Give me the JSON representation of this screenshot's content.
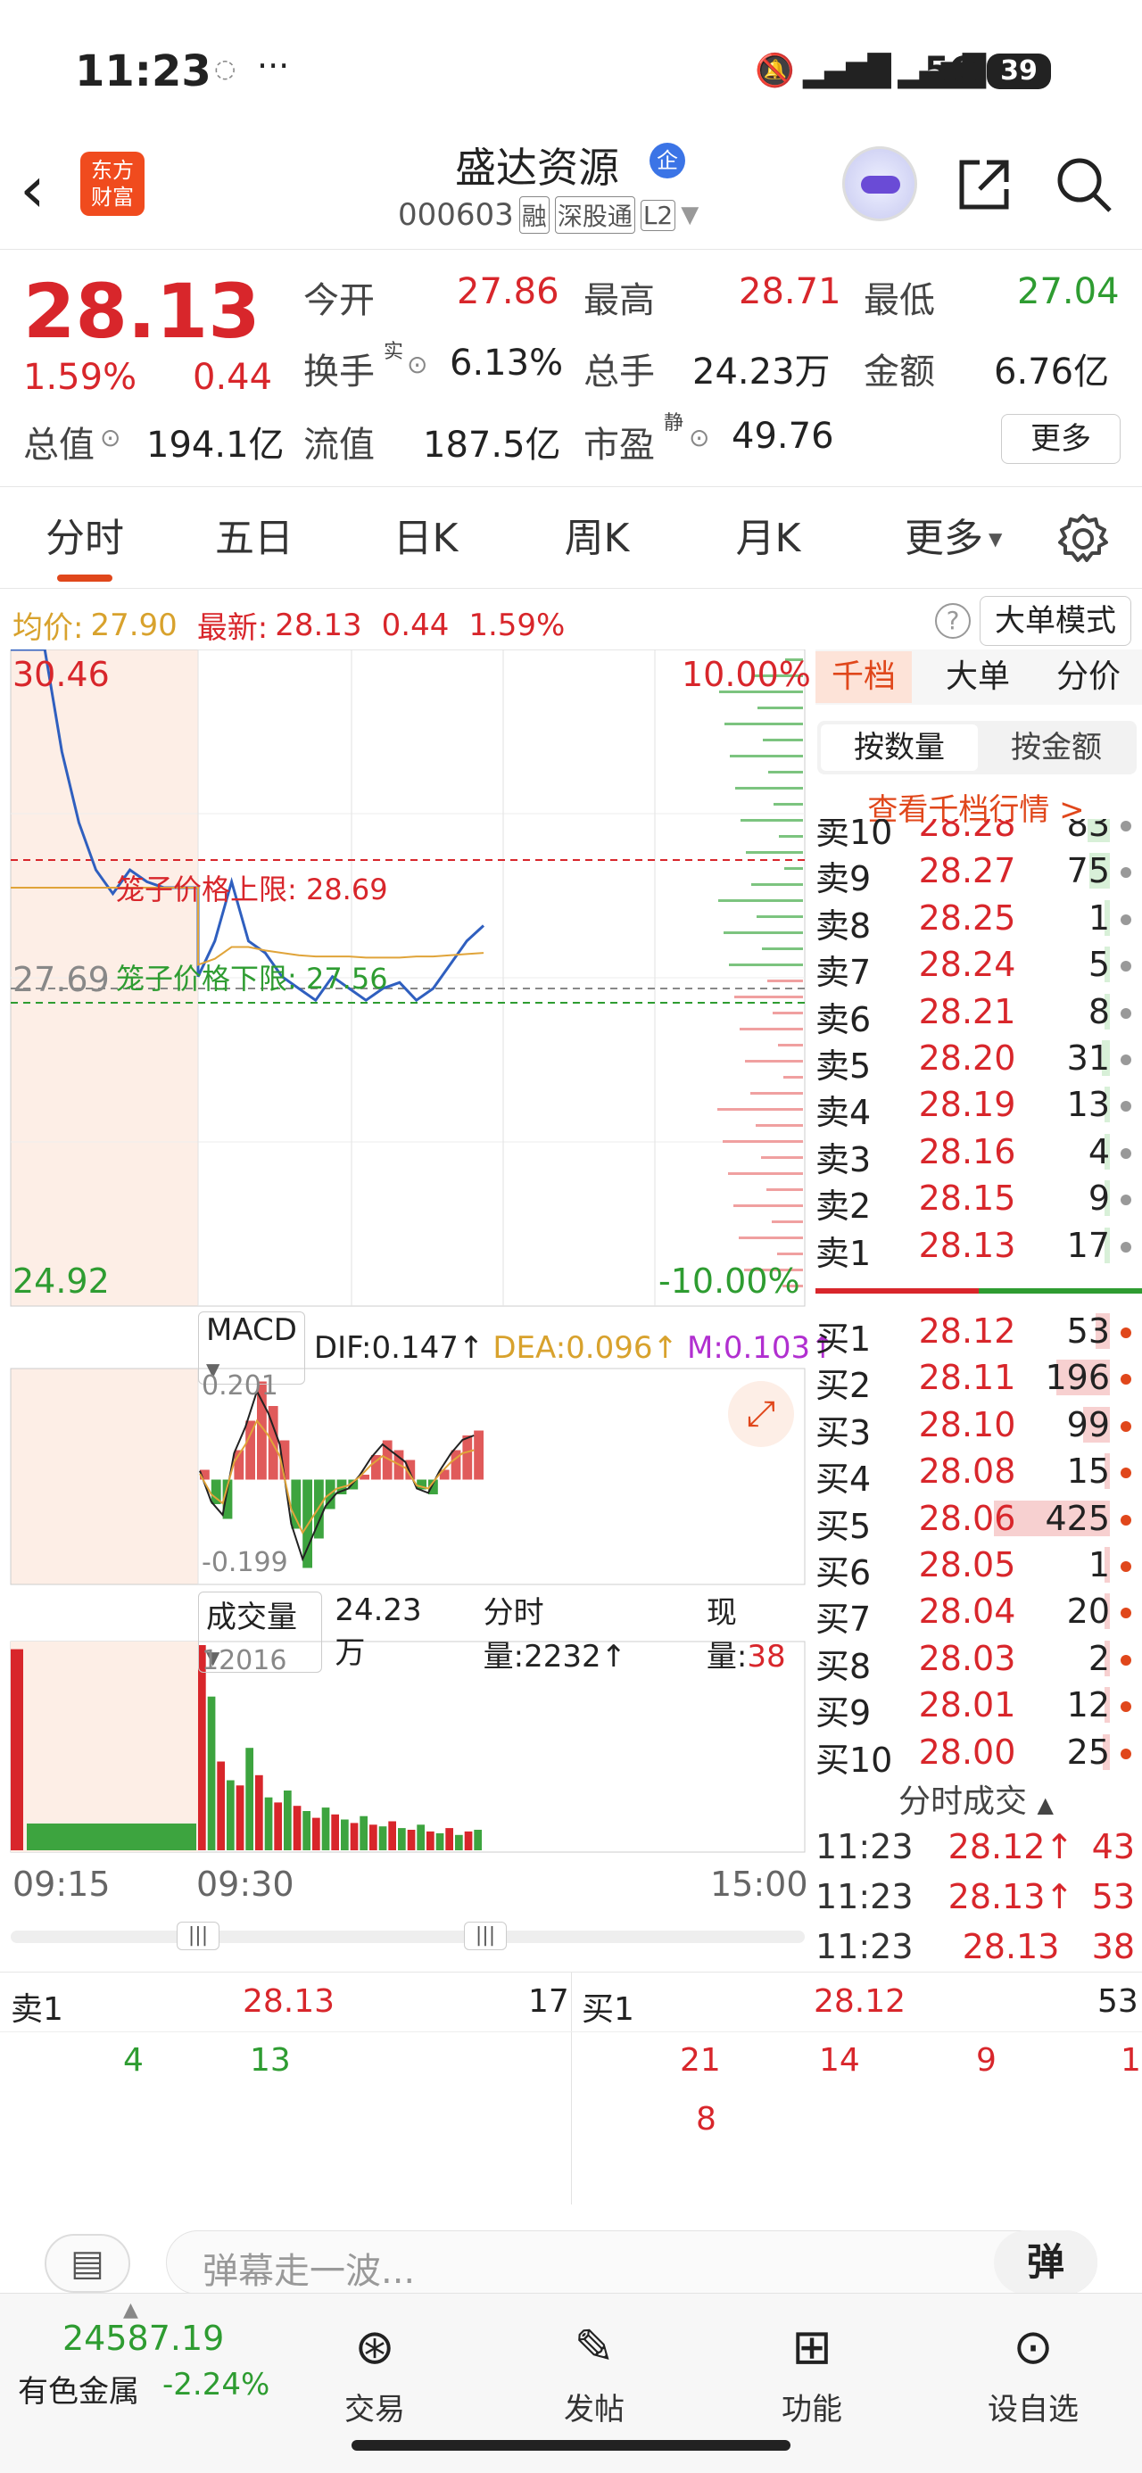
{
  "status_bar": {
    "time": "11:23",
    "network": "5G",
    "battery": "39"
  },
  "header": {
    "logo_line1": "东方",
    "logo_line2": "财富",
    "stock_name": "盛达资源",
    "badge": "企",
    "code": "000603",
    "tags": [
      "融",
      "深股通",
      "L2"
    ]
  },
  "quote": {
    "price": "28.13",
    "change_pct": "1.59%",
    "change": "0.44",
    "fields": [
      {
        "label": "今开",
        "value": "27.86"
      },
      {
        "label": "最高",
        "value": "28.71"
      },
      {
        "label": "最低",
        "value": "27.04"
      },
      {
        "label": "换手",
        "sup": "实",
        "value": "6.13%"
      },
      {
        "label": "总手",
        "value": "24.23万"
      },
      {
        "label": "金额",
        "value": "6.76亿"
      },
      {
        "label": "总值",
        "value": "194.1亿"
      },
      {
        "label": "流值",
        "value": "187.5亿"
      },
      {
        "label": "市盈",
        "sup": "静",
        "value": "49.76"
      }
    ],
    "more_button": "更多"
  },
  "tabs": [
    "分时",
    "五日",
    "日K",
    "周K",
    "月K",
    "更多"
  ],
  "info_bar": {
    "avg_label": "均价:",
    "avg": "27.90",
    "latest_label": "最新:",
    "latest": "28.13",
    "change": "0.44",
    "change_pct": "1.59%",
    "mode_button": "大单模式"
  },
  "chart_data": [
    {
      "type": "line",
      "title": "分时",
      "y_labels": {
        "top": "30.46",
        "ref": "27.69",
        "bottom": "24.92",
        "top_pct": "10.00%",
        "bottom_pct": "-10.00%"
      },
      "ylim": [
        24.92,
        30.46
      ],
      "annotations": [
        "笼子价格上限: 28.69",
        "笼子价格下限: 27.56"
      ],
      "x_labels": [
        "09:15",
        "09:30",
        "15:00"
      ],
      "series": [
        {
          "name": "最新",
          "values": [
            30.46,
            30.46,
            30.46,
            29.6,
            29.0,
            28.6,
            28.4,
            28.6,
            28.5,
            28.45,
            28.45,
            28.45,
            27.7,
            28.0,
            28.5,
            28.0,
            27.9,
            27.7,
            27.6,
            27.5,
            27.7,
            27.6,
            27.5,
            27.6,
            27.65,
            27.5,
            27.6,
            27.8,
            28.0,
            28.13
          ]
        },
        {
          "name": "均价",
          "values": [
            28.45,
            28.45,
            28.45,
            28.45,
            28.45,
            28.45,
            28.45,
            28.45,
            28.45,
            28.45,
            28.45,
            28.45,
            27.8,
            27.85,
            27.95,
            27.95,
            27.92,
            27.9,
            27.88,
            27.87,
            27.87,
            27.87,
            27.86,
            27.86,
            27.86,
            27.87,
            27.87,
            27.88,
            27.89,
            27.9
          ]
        }
      ]
    },
    {
      "type": "bar",
      "title": "MACD",
      "indicators": [
        {
          "name": "DIF",
          "value": "0.147"
        },
        {
          "name": "DEA",
          "value": "0.096"
        },
        {
          "name": "M",
          "value": "0.103"
        }
      ],
      "y_labels": {
        "top": "0.201",
        "bottom": "-0.199"
      },
      "ylim": [
        -0.199,
        0.201
      ],
      "values": [
        0.02,
        -0.05,
        -0.08,
        0.06,
        0.12,
        0.2,
        0.15,
        0.08,
        -0.1,
        -0.18,
        -0.12,
        -0.06,
        -0.03,
        -0.02,
        0.01,
        0.05,
        0.08,
        0.06,
        0.04,
        -0.02,
        -0.03,
        0.02,
        0.06,
        0.09,
        0.1
      ]
    },
    {
      "type": "bar",
      "title": "成交量",
      "indicators": [
        {
          "name": "成交量",
          "value": "24.23万"
        },
        {
          "name": "分时量",
          "value": "2232"
        },
        {
          "name": "现量",
          "value": "38"
        }
      ],
      "y_labels": {
        "top": "12016"
      },
      "ylim": [
        0,
        12016
      ],
      "values": [
        12016,
        9000,
        5200,
        4100,
        3800,
        6000,
        4400,
        3100,
        2800,
        3500,
        2600,
        2300,
        1900,
        2500,
        2100,
        1800,
        1600,
        2000,
        1500,
        1400,
        1700,
        1300,
        1200,
        1500,
        1100,
        1000,
        1300,
        900,
        1100,
        1200
      ]
    }
  ],
  "orderbook": {
    "tabs": [
      "千档",
      "大单",
      "分价"
    ],
    "sub_tabs": [
      "按数量",
      "按金额"
    ],
    "link": "查看千档行情 >",
    "sells": [
      {
        "label": "卖10",
        "price": "28.28",
        "vol": "83"
      },
      {
        "label": "卖9",
        "price": "28.27",
        "vol": "75"
      },
      {
        "label": "卖8",
        "price": "28.25",
        "vol": "1"
      },
      {
        "label": "卖7",
        "price": "28.24",
        "vol": "5"
      },
      {
        "label": "卖6",
        "price": "28.21",
        "vol": "8"
      },
      {
        "label": "卖5",
        "price": "28.20",
        "vol": "31"
      },
      {
        "label": "卖4",
        "price": "28.19",
        "vol": "13"
      },
      {
        "label": "卖3",
        "price": "28.16",
        "vol": "4"
      },
      {
        "label": "卖2",
        "price": "28.15",
        "vol": "9"
      },
      {
        "label": "卖1",
        "price": "28.13",
        "vol": "17"
      }
    ],
    "buys": [
      {
        "label": "买1",
        "price": "28.12",
        "vol": "53"
      },
      {
        "label": "买2",
        "price": "28.11",
        "vol": "196"
      },
      {
        "label": "买3",
        "price": "28.10",
        "vol": "99"
      },
      {
        "label": "买4",
        "price": "28.08",
        "vol": "15"
      },
      {
        "label": "买5",
        "price": "28.06",
        "vol": "425"
      },
      {
        "label": "买6",
        "price": "28.05",
        "vol": "1"
      },
      {
        "label": "买7",
        "price": "28.04",
        "vol": "20"
      },
      {
        "label": "买8",
        "price": "28.03",
        "vol": "2"
      },
      {
        "label": "买9",
        "price": "28.01",
        "vol": "12"
      },
      {
        "label": "买10",
        "price": "28.00",
        "vol": "25"
      }
    ],
    "ticks_title": "分时成交",
    "ticks": [
      {
        "time": "11:23",
        "price": "28.12↑",
        "vol": "43"
      },
      {
        "time": "11:23",
        "price": "28.13↑",
        "vol": "53"
      },
      {
        "time": "11:23",
        "price": "28.13",
        "vol": "38"
      }
    ]
  },
  "deal_queue": {
    "sell": {
      "label": "卖1",
      "price": "28.13",
      "vol": "17",
      "queue": [
        "4",
        "13"
      ]
    },
    "buy": {
      "label": "买1",
      "price": "28.12",
      "vol": "53",
      "queue": [
        "21",
        "14",
        "9",
        "1",
        "8"
      ]
    }
  },
  "danmu": {
    "placeholder": "弹幕走一波...",
    "button": "弹"
  },
  "bottom_bar": {
    "index_value": "24587.19",
    "index_name": "有色金属",
    "index_change": "-2.24%",
    "items": [
      "交易",
      "发帖",
      "功能",
      "设自选"
    ]
  }
}
